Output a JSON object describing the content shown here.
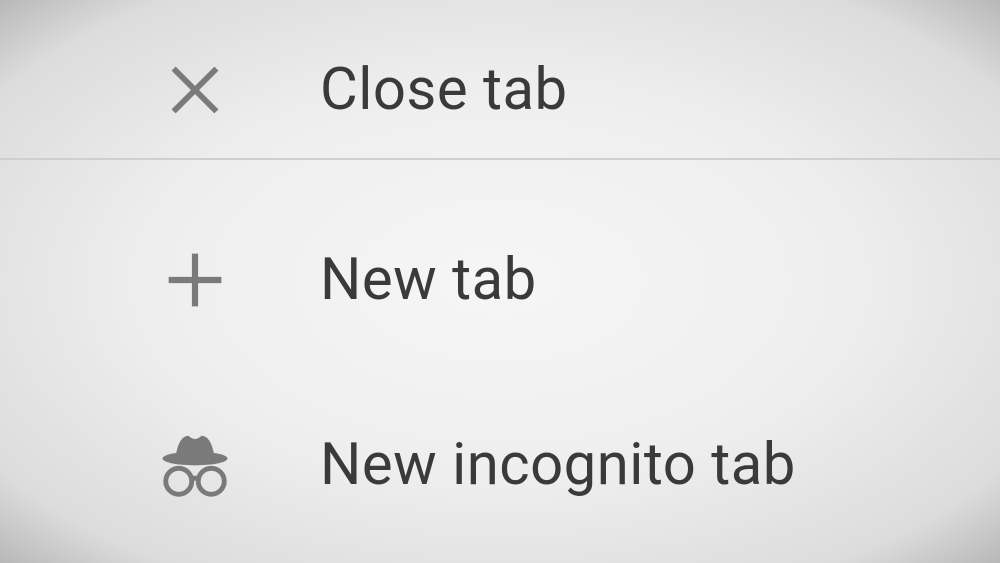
{
  "menu": {
    "items": [
      {
        "label": "Close tab"
      },
      {
        "label": "New tab"
      },
      {
        "label": "New incognito tab"
      }
    ]
  },
  "colors": {
    "icon": "#7a7a7a",
    "text": "#3a3a3a",
    "divider": "#cfcfcf"
  }
}
